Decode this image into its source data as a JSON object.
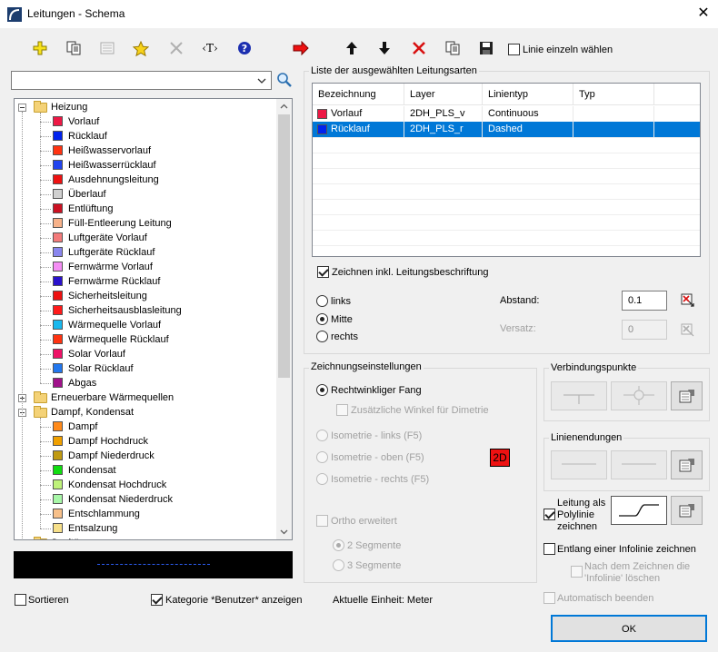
{
  "window": {
    "title": "Leitungen - Schema",
    "close_glyph": "✕"
  },
  "toolbar": {
    "text_tool_label": "‹T›",
    "help_glyph": "?",
    "single_line_checkbox_label": "Linie einzeln wählen",
    "single_line_checked": false
  },
  "search": {
    "value": "",
    "icon": "magnifier-icon"
  },
  "tree": {
    "items": [
      {
        "label": "Heizung",
        "level": 0,
        "type": "folder",
        "expanded": true
      },
      {
        "label": "Vorlauf",
        "level": 1,
        "color": "#ee1845"
      },
      {
        "label": "Rücklauf",
        "level": 1,
        "color": "#0022ee"
      },
      {
        "label": "Heißwasservorlauf",
        "level": 1,
        "color": "#ff3311"
      },
      {
        "label": "Heißwasserrücklauf",
        "level": 1,
        "color": "#2244ee"
      },
      {
        "label": "Ausdehnungsleitung",
        "level": 1,
        "color": "#ee1111"
      },
      {
        "label": "Überlauf",
        "level": 1,
        "color": "#d0d0d0"
      },
      {
        "label": "Entlüftung",
        "level": 1,
        "color": "#cc1122"
      },
      {
        "label": "Füll-Entleerung Leitung",
        "level": 1,
        "color": "#f7b28a"
      },
      {
        "label": "Luftgeräte Vorlauf",
        "level": 1,
        "color": "#f47b7b"
      },
      {
        "label": "Luftgeräte Rücklauf",
        "level": 1,
        "color": "#8a86ee"
      },
      {
        "label": "Fernwärme Vorlauf",
        "level": 1,
        "color": "#f58ef5"
      },
      {
        "label": "Fernwärme Rücklauf",
        "level": 1,
        "color": "#2a11cc"
      },
      {
        "label": "Sicherheitsleitung",
        "level": 1,
        "color": "#ee1111"
      },
      {
        "label": "Sicherheitsausblasleitung",
        "level": 1,
        "color": "#ff1a1a"
      },
      {
        "label": "Wärmequelle Vorlauf",
        "level": 1,
        "color": "#18b8ee"
      },
      {
        "label": "Wärmequelle Rücklauf",
        "level": 1,
        "color": "#ff3311"
      },
      {
        "label": "Solar Vorlauf",
        "level": 1,
        "color": "#ee1166"
      },
      {
        "label": "Solar Rücklauf",
        "level": 1,
        "color": "#2277ee"
      },
      {
        "label": "Abgas",
        "level": 1,
        "color": "#a0118a"
      },
      {
        "label": "Erneuerbare Wärmequellen",
        "level": 0,
        "type": "folder",
        "expanded": false
      },
      {
        "label": "Dampf, Kondensat",
        "level": 0,
        "type": "folder",
        "expanded": true
      },
      {
        "label": "Dampf",
        "level": 1,
        "color": "#ff8a1a"
      },
      {
        "label": "Dampf Hochdruck",
        "level": 1,
        "color": "#f0a000"
      },
      {
        "label": "Dampf Niederdruck",
        "level": 1,
        "color": "#c09a11"
      },
      {
        "label": "Kondensat",
        "level": 1,
        "color": "#11dd11"
      },
      {
        "label": "Kondensat Hochdruck",
        "level": 1,
        "color": "#bff27a"
      },
      {
        "label": "Kondensat Niederdruck",
        "level": 1,
        "color": "#a8f7a8"
      },
      {
        "label": "Entschlammung",
        "level": 1,
        "color": "#f7c08a"
      },
      {
        "label": "Entsalzung",
        "level": 1,
        "color": "#f7e08a"
      },
      {
        "label": "Sanitär",
        "level": 0,
        "type": "folder",
        "expanded": false
      }
    ]
  },
  "bottom": {
    "sort_label": "Sortieren",
    "sort_checked": false,
    "category_label": "Kategorie *Benutzer* anzeigen",
    "category_checked": true,
    "unit_label": "Aktuelle Einheit: Meter"
  },
  "selected_list": {
    "group_title": "Liste der ausgewählten Leitungsarten",
    "columns": [
      "Bezeichnung",
      "Layer",
      "Linientyp",
      "Typ"
    ],
    "rows": [
      {
        "name": "Vorlauf",
        "layer": "2DH_PLS_v",
        "linetype": "Continuous",
        "typ": "",
        "color": "#ee1845",
        "selected": false
      },
      {
        "name": "Rücklauf",
        "layer": "2DH_PLS_r",
        "linetype": "Dashed",
        "typ": "",
        "color": "#0022ee",
        "selected": true
      }
    ]
  },
  "draw_with_label": {
    "label": "Zeichnen inkl. Leitungsbeschriftung",
    "checked": true
  },
  "position": {
    "options": [
      "links",
      "Mitte",
      "rechts"
    ],
    "selected": "Mitte",
    "spacing_label": "Abstand:",
    "spacing_value": "0.1",
    "offset_label": "Versatz:",
    "offset_value": "0"
  },
  "drawing_settings": {
    "title": "Zeichnungseinstellungen",
    "right_angle": "Rechtwinkliger Fang",
    "dimetric": "Zusätzliche Winkel für Dimetrie",
    "iso_left": "Isometrie - links (F5)",
    "iso_top": "Isometrie - oben (F5)",
    "iso_right": "Isometrie - rechts (F5)",
    "badge_2d": "2D",
    "ortho": "Ortho erweitert",
    "seg2": "2 Segmente",
    "seg3": "3 Segmente"
  },
  "connection_points": {
    "title": "Verbindungspunkte"
  },
  "line_endings": {
    "title": "Linienendungen"
  },
  "polyline": {
    "label_line1": "Leitung als",
    "label_line2": "Polylinie",
    "label_line3": "zeichnen",
    "checked": true
  },
  "infoline": {
    "label": "Entlang einer Infolinie zeichnen",
    "checked": false
  },
  "delete_infoline": {
    "label_line1": "Nach dem Zeichnen die",
    "label_line2": "'Infolinie' löschen",
    "checked": false
  },
  "auto_finish": {
    "label": "Automatisch beenden",
    "checked": false
  },
  "ok_button": {
    "label": "OK"
  },
  "colors": {
    "accent": "#0078d7",
    "ok_border": "#0078d7"
  }
}
